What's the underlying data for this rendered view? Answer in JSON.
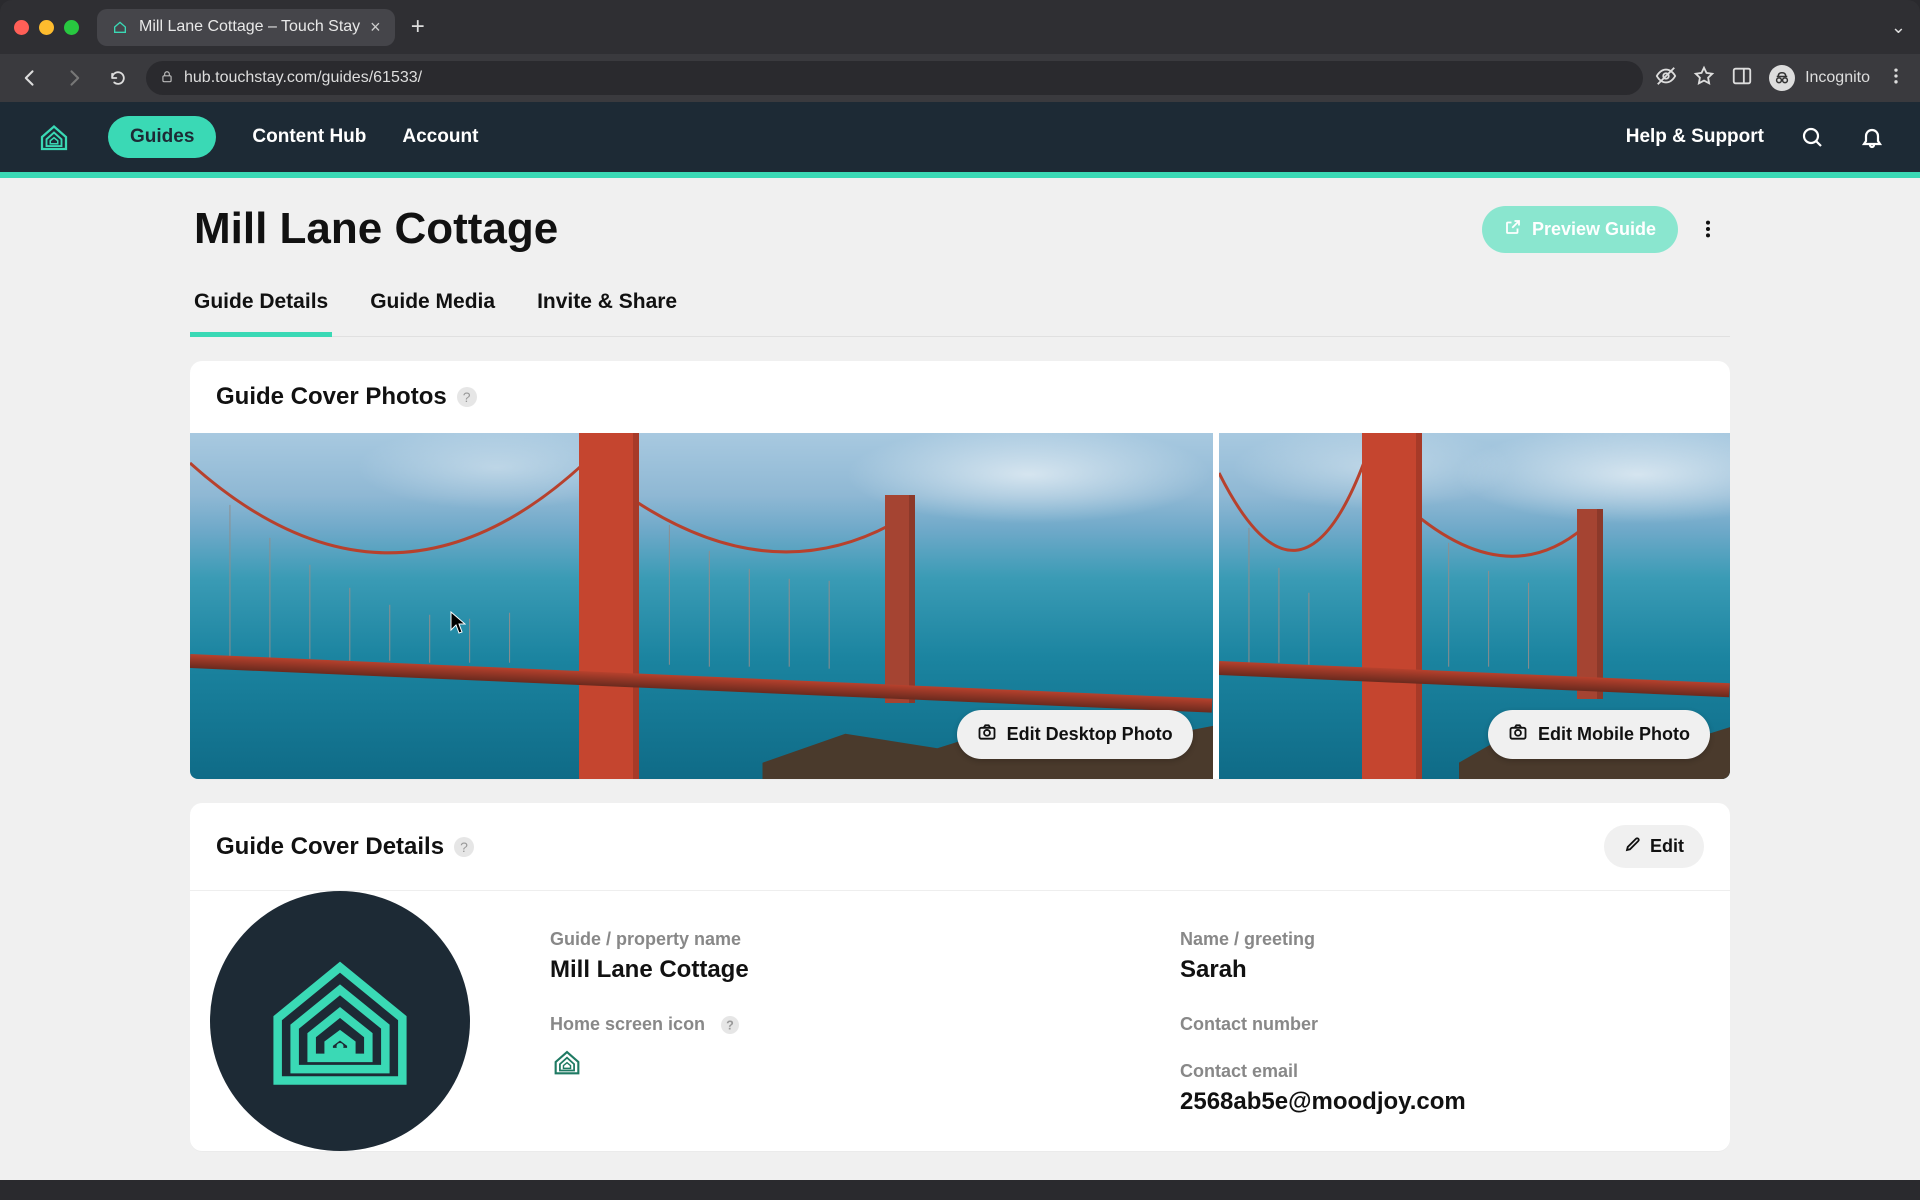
{
  "browser": {
    "tab_title": "Mill Lane Cottage – Touch Stay",
    "url": "hub.touchstay.com/guides/61533/",
    "incognito_label": "Incognito"
  },
  "nav": {
    "guides": "Guides",
    "content_hub": "Content Hub",
    "account": "Account",
    "help": "Help & Support"
  },
  "page": {
    "title": "Mill Lane Cottage",
    "preview_button": "Preview Guide",
    "tabs": {
      "details": "Guide Details",
      "media": "Guide Media",
      "invite": "Invite & Share"
    }
  },
  "cover_photos": {
    "section_title": "Guide Cover Photos",
    "edit_desktop": "Edit Desktop Photo",
    "edit_mobile": "Edit Mobile Photo"
  },
  "cover_details": {
    "section_title": "Guide Cover Details",
    "edit": "Edit",
    "labels": {
      "property_name": "Guide / property name",
      "greeting": "Name / greeting",
      "home_icon": "Home screen icon",
      "contact_number": "Contact number",
      "contact_email": "Contact email"
    },
    "values": {
      "property_name": "Mill Lane Cottage",
      "greeting": "Sarah",
      "contact_email": "2568ab5e@moodjoy.com"
    }
  }
}
